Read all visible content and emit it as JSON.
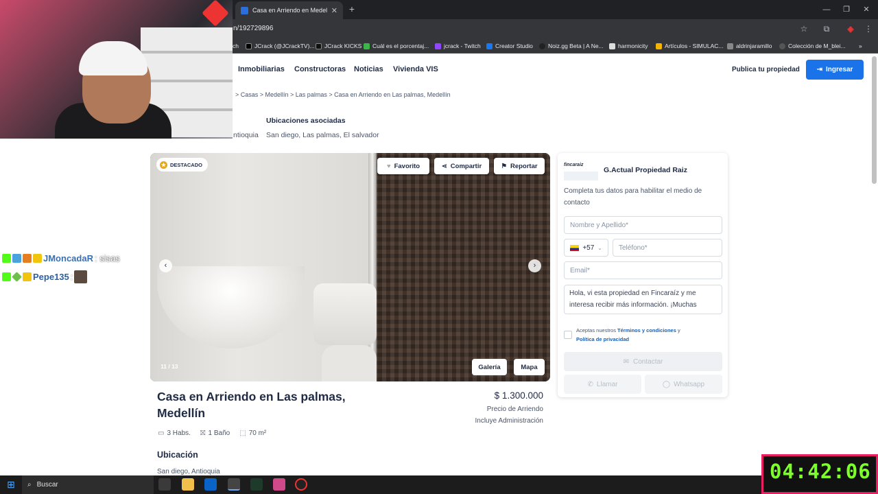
{
  "browser": {
    "tab_title": "Casa en Arriendo en Medellín, L",
    "url_fragment": "n/192729896",
    "bookmarks": [
      "ch",
      "JCrack (@JCrackTV)...",
      "JCrack KICKS",
      "Cuál es el porcentaj...",
      "jcrack - Twitch",
      "Creator Studio",
      "Noiz.gg Beta | A Ne...",
      "harmonicity",
      "Artículos - SIMULAC...",
      "aldrinjaramillo",
      "Colección de M_blei..."
    ]
  },
  "nav": {
    "links": [
      "Inmobiliarias",
      "Constructoras",
      "Noticias",
      "Vivienda VIS"
    ],
    "publica": "Publica tu propiedad",
    "ingresar": "Ingresar"
  },
  "breadcrumb": ">  Casas  >  Medellín  >  Las palmas  >  Casa en Arriendo en Las palmas, Medellín",
  "ubicaciones": {
    "heading": "Ubicaciones asociadas",
    "value": "San diego, Las palmas, El salvador",
    "partial": "ntioquia"
  },
  "gallery": {
    "badge": "DESTACADO",
    "favorito": "Favorito",
    "compartir": "Compartir",
    "reportar": "Reportar",
    "counter": "11 / 13",
    "galeria": "Galería",
    "mapa": "Mapa"
  },
  "listing": {
    "title": "Casa en Arriendo en Las palmas, Medellín",
    "price": "$ 1.300.000",
    "price_label": "Precio de Arriendo",
    "includes": "Incluye Administración",
    "habs": "3 Habs.",
    "banos": "1 Baño",
    "area": "70 m²",
    "ubicacion_h": "Ubicación",
    "ubicacion_v": "San diego, Antioquia"
  },
  "contact": {
    "logo": "fincaraiz",
    "agent": "G.Actual Propiedad Raiz",
    "intro": "Completa tus datos para habilitar el medio de contacto",
    "name_ph": "Nombre y Apellido*",
    "phone_code": "+57",
    "phone_ph": "Teléfono*",
    "email_ph": "Email*",
    "message": "Hola, vi esta propiedad en Fincaraíz y me interesa recibir más información. ¡Muchas",
    "terms_pre": "Aceptas nuestros",
    "terms_link": "Términos y condiciones",
    "terms_y": "y",
    "privacy_link": "Política de privacidad",
    "contactar": "Contactar",
    "llamar": "Llamar",
    "whatsapp": "Whatsapp"
  },
  "chat": [
    {
      "user": "JMoncadaR",
      "message": ": sisas"
    },
    {
      "user": "Pepe135",
      "message": ":"
    }
  ],
  "timer": "04:42:06",
  "taskbar": {
    "search": "Buscar"
  }
}
